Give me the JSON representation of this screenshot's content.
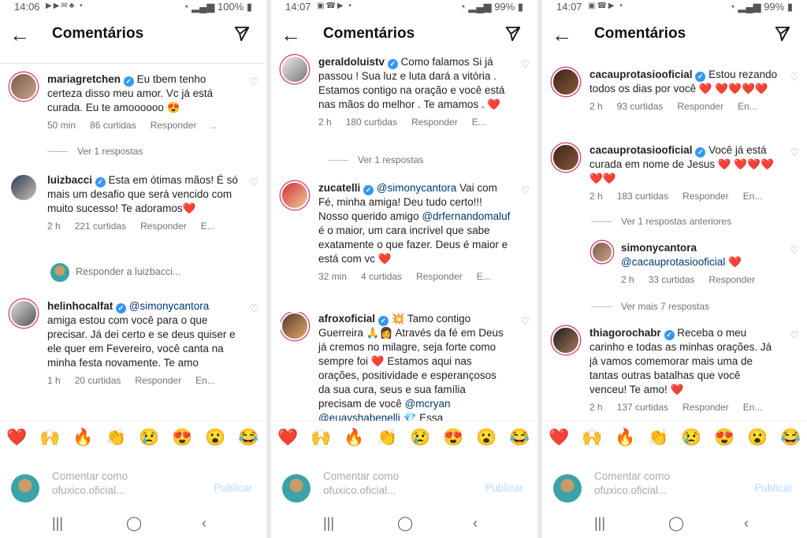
{
  "header": {
    "title": "Comentários"
  },
  "actions": {
    "reply": "Responder",
    "publish": "Publicar"
  },
  "composer": {
    "placeholder": "Comentar como ofuxico.oficial..."
  },
  "emojis": [
    "❤️",
    "🙌",
    "🔥",
    "👏",
    "😢",
    "😍",
    "😮",
    "😂"
  ],
  "panel1": {
    "status": {
      "time": "14:06",
      "battery": "100%"
    },
    "c1": {
      "user": "mariagretchen",
      "text": "Eu tbem tenho certeza disso meu amor. Vc já está curada. Eu te amoooooo 😍",
      "time": "50 min",
      "likes": "86 curtidas",
      "more": ".."
    },
    "r1": "Ver 1 respostas",
    "c2": {
      "user": "luizbacci",
      "text": "Esta em ótimas mãos! É só mais um desafio que será vencido com muito sucesso! Te adoramos❤️",
      "time": "2 h",
      "likes": "221 curtidas",
      "more": "E..."
    },
    "reply_to": "Responder a luizbacci...",
    "c3": {
      "user": "helinhocalfat",
      "mention": "@simonycantora",
      "text": "amiga estou com você para o que precisar. Já dei certo e se deus quiser e ele quer em Fevereiro, você canta na minha festa novamente. Te amo",
      "time": "1 h",
      "likes": "20 curtidas",
      "more": "En..."
    }
  },
  "panel2": {
    "status": {
      "time": "14:07",
      "battery": "99%"
    },
    "c1": {
      "user": "geraldoluistv",
      "text": "Como falamos Si já passou ! Sua luz e luta dará a vitória . Estamos contigo na oração e você está nas mãos do melhor . Te amamos . ❤️",
      "time": "2 h",
      "likes": "180 curtidas",
      "more": "E..."
    },
    "r1": "Ver 1 respostas",
    "c2": {
      "user": "zucatelli",
      "mention": "@simonycantora",
      "text": "Vai com Fé, minha amiga! Deu tudo certo!!! Nosso querido amigo",
      "mention2": "@drfernandomaluf",
      "text2": "é o maior, um cara incrível que sabe exatamente o que fazer. Deus é maior e está com vc ❤️",
      "time": "32 min",
      "likes": "4 curtidas",
      "more": "E..."
    },
    "c3": {
      "user": "afroxoficial",
      "text": "💥 Tamo contigo Guerreira 🙏👩 Através da fé em Deus já cremos no milagre, seja forte como sempre foi ❤️ Estamos aqui nas orações, positividade e esperançosos da sua cura, seus e sua família precisam de você",
      "mention": "@mcryan @euayshabenelli",
      "text2": "💎 Essa"
    }
  },
  "panel3": {
    "status": {
      "time": "14:07",
      "battery": "99%"
    },
    "c1": {
      "user": "cacauprotasiooficial",
      "text": "Estou rezando todos os dias por você ❤️ ❤️❤️❤️❤️",
      "time": "2 h",
      "likes": "93 curtidas",
      "more": "En..."
    },
    "c2": {
      "user": "cacauprotasiooficial",
      "text": "Você já está curada em nome de Jesus ❤️ ❤️❤️❤️❤️❤️",
      "time": "2 h",
      "likes": "183 curtidas",
      "more": "En..."
    },
    "r1": "Ver 1 respostas anteriores",
    "reply": {
      "user": "simonycantora",
      "mention": "@cacauprotasiooficial",
      "text": "❤️",
      "time": "2 h",
      "likes": "33 curtidas"
    },
    "r2": "Ver mais 7 respostas",
    "c3": {
      "user": "thiagorochabr",
      "text": "Receba o meu carinho e todas as minhas orações. Já já vamos comemorar mais uma de tantas outras batalhas que você venceu! Te amo! ❤️",
      "time": "2 h",
      "likes": "137 curtidas",
      "more": "En..."
    }
  }
}
